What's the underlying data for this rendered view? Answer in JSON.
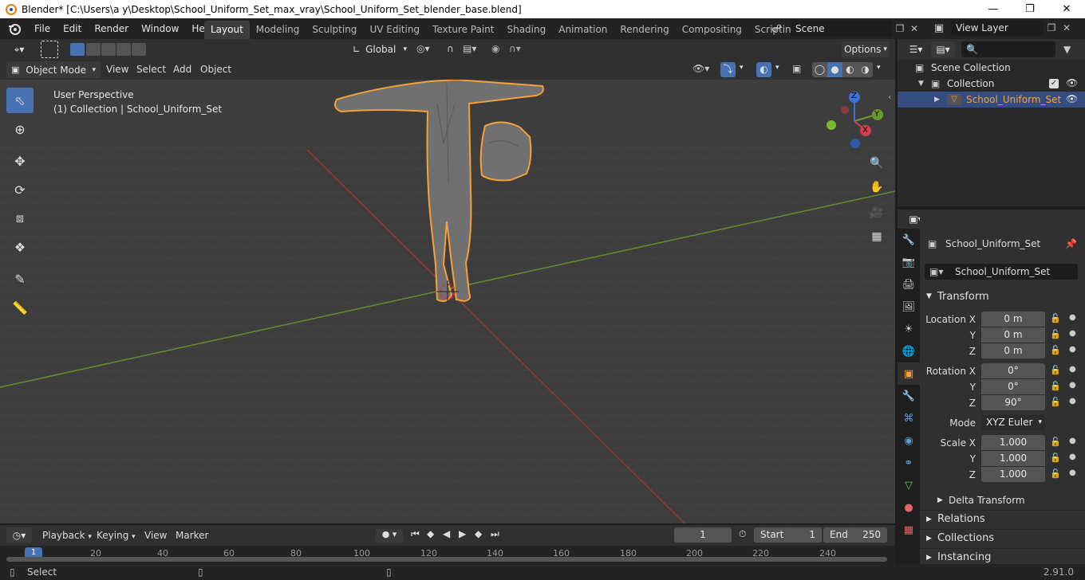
{
  "window": {
    "title": "Blender* [C:\\Users\\a y\\Desktop\\School_Uniform_Set_max_vray\\School_Uniform_Set_blender_base.blend]"
  },
  "menu": [
    "File",
    "Edit",
    "Render",
    "Window",
    "Help"
  ],
  "workspaces": [
    "Layout",
    "Modeling",
    "Sculpting",
    "UV Editing",
    "Texture Paint",
    "Shading",
    "Animation",
    "Rendering",
    "Compositing",
    "Scripting"
  ],
  "active_workspace": "Layout",
  "scene": {
    "name": "Scene",
    "view_layer": "View Layer"
  },
  "viewport_header": {
    "orientation": "Global",
    "options": "Options",
    "mode": "Object Mode",
    "menus": [
      "View",
      "Select",
      "Add",
      "Object"
    ]
  },
  "viewport_info": {
    "line1": "User Perspective",
    "line2": "(1) Collection | School_Uniform_Set"
  },
  "gizmo": {
    "z": "Z",
    "y": "Y",
    "x": "X"
  },
  "outliner": {
    "root": "Scene Collection",
    "collection": "Collection",
    "object": "School_Uniform_Set"
  },
  "properties": {
    "object_name": "School_Uniform_Set",
    "data_name": "School_Uniform_Set",
    "transform_title": "Transform",
    "location": {
      "label_x": "Location X",
      "x": "0 m",
      "y": "0 m",
      "z": "0 m"
    },
    "rotation": {
      "label_x": "Rotation X",
      "x": "0°",
      "y": "0°",
      "z": "90°"
    },
    "mode_label": "Mode",
    "mode": "XYZ Euler",
    "scale": {
      "label_x": "Scale X",
      "x": "1.000",
      "y": "1.000",
      "z": "1.000"
    },
    "axis_y": "Y",
    "axis_z": "Z",
    "delta": "Delta Transform",
    "sections": [
      "Relations",
      "Collections",
      "Instancing"
    ]
  },
  "timeline": {
    "menus": [
      "Playback",
      "Keying",
      "View",
      "Marker"
    ],
    "current_frame": "1",
    "start_label": "Start",
    "start": "1",
    "end_label": "End",
    "end": "250",
    "ruler": [
      "1",
      "20",
      "40",
      "60",
      "80",
      "100",
      "120",
      "140",
      "160",
      "180",
      "200",
      "220",
      "240"
    ]
  },
  "status": {
    "left": "Select",
    "version": "2.91.0"
  },
  "colors": {
    "accent": "#4772b3",
    "selection": "#f5a03a",
    "bg_viewport": "#3d3d3d"
  }
}
